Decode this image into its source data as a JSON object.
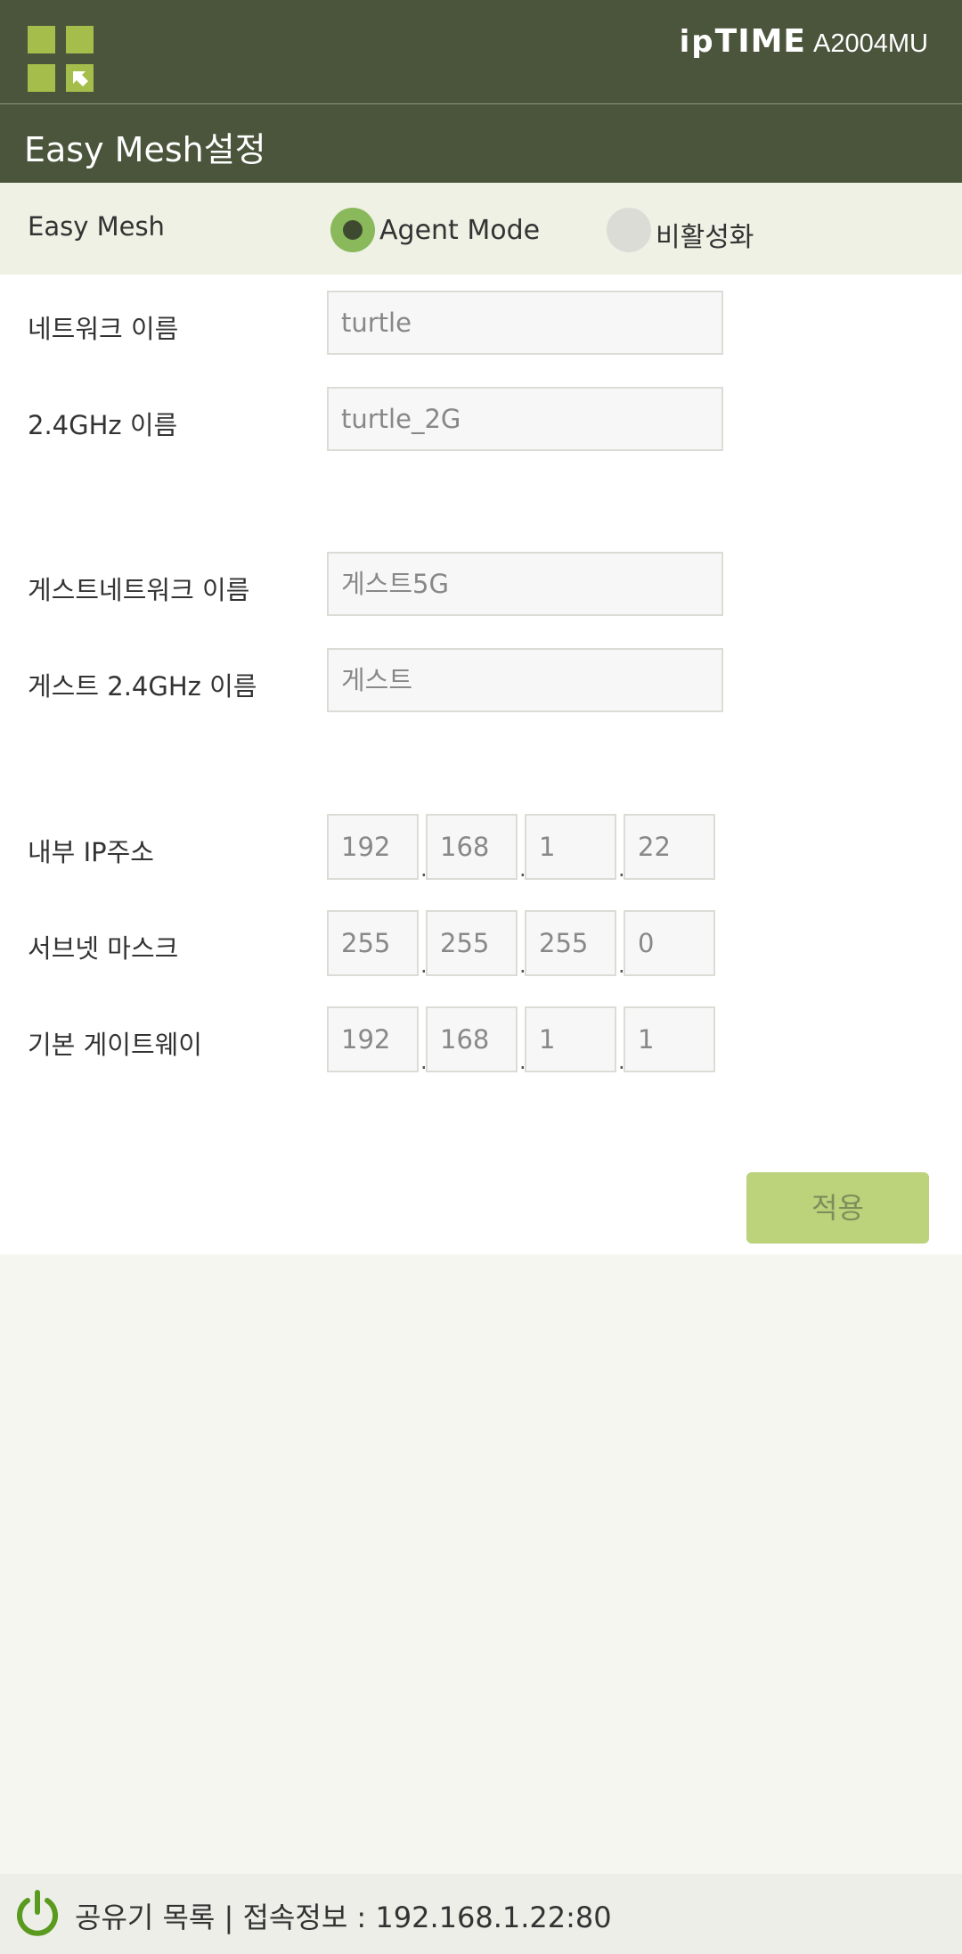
{
  "header": {
    "brand_ip": "ip",
    "brand_time": "TIME",
    "model": "A2004MU"
  },
  "page_title": "Easy Mesh설정",
  "mesh": {
    "label": "Easy Mesh",
    "options": [
      "Agent Mode",
      "비활성화"
    ],
    "selected": "Agent Mode"
  },
  "fields": {
    "network_name": {
      "label": "네트워크 이름",
      "value": "turtle"
    },
    "name_24": {
      "label": "2.4GHz 이름",
      "value": "turtle_2G"
    },
    "guest_network_name": {
      "label": "게스트네트워크 이름",
      "value": "게스트5G"
    },
    "guest_name_24": {
      "label": "게스트 2.4GHz 이름",
      "value": "게스트"
    }
  },
  "ip": {
    "internal": {
      "label": "내부 IP주소",
      "octets": [
        "192",
        "168",
        "1",
        "22"
      ]
    },
    "subnet": {
      "label": "서브넷 마스크",
      "octets": [
        "255",
        "255",
        "255",
        "0"
      ]
    },
    "gateway": {
      "label": "기본 게이트웨이",
      "octets": [
        "192",
        "168",
        "1",
        "1"
      ]
    }
  },
  "apply_label": "적용",
  "footer": {
    "text": "공유기 목록 | 접속정보 : 192.168.1.22:80"
  },
  "colors": {
    "header_bg": "#4a553c",
    "accent": "#a5bd4a",
    "radio_selected": "#8ab95b",
    "apply_bg": "#bcd37c"
  },
  "icons": [
    "grid-menu-icon",
    "power-icon"
  ]
}
